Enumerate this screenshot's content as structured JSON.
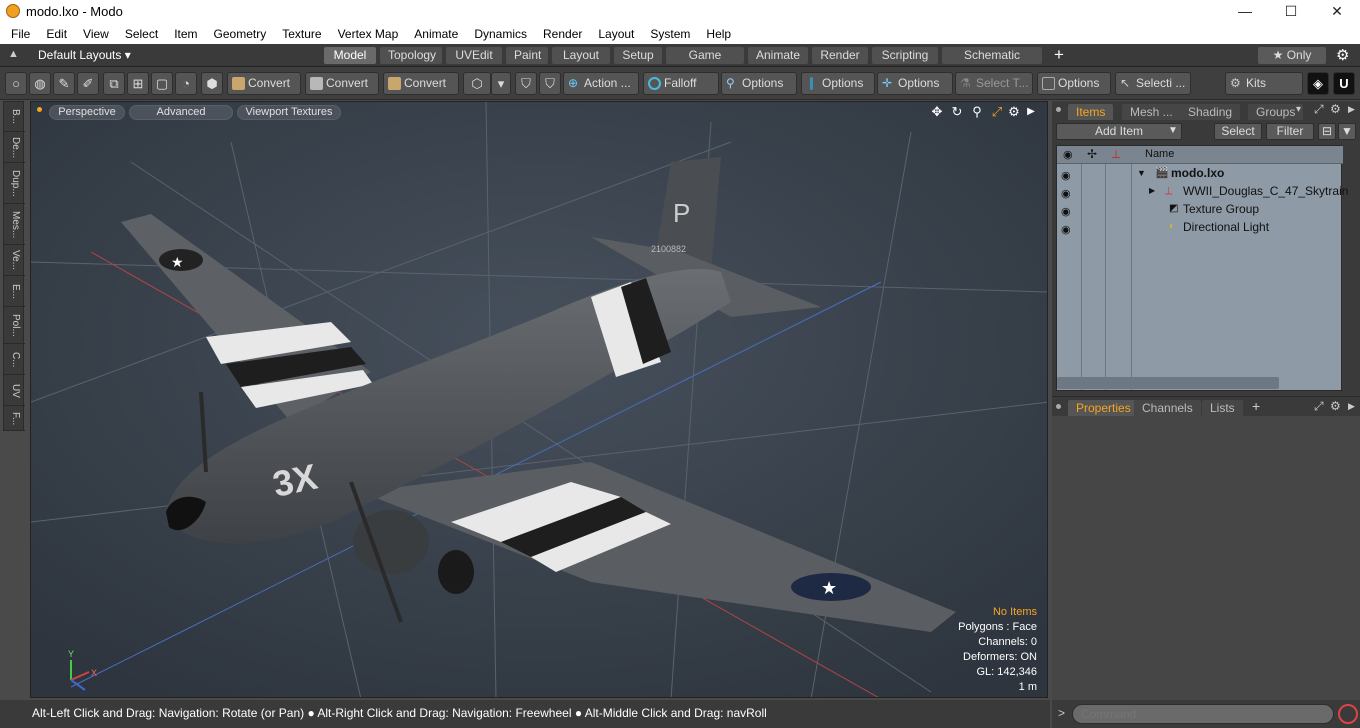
{
  "window": {
    "title": "modo.lxo - Modo",
    "minimize": "—",
    "maximize": "☐",
    "close": "✕"
  },
  "menu": [
    "File",
    "Edit",
    "View",
    "Select",
    "Item",
    "Geometry",
    "Texture",
    "Vertex Map",
    "Animate",
    "Dynamics",
    "Render",
    "Layout",
    "System",
    "Help"
  ],
  "layouts": {
    "label": "Default Layouts ▾"
  },
  "layout_tabs": [
    "Model",
    "Topology",
    "UVEdit",
    "Paint",
    "Layout",
    "Setup",
    "Game Tools",
    "Animate",
    "Render",
    "Scripting",
    "Schematic Fusion"
  ],
  "active_layout_tab": "Model",
  "only_label": "★ Only",
  "toolbar": {
    "convert1": "Convert",
    "convert2": "Convert",
    "convert3": "Convert",
    "action": "Action ...",
    "falloff": "Falloff",
    "options1": "Options",
    "options2": "Options",
    "options3": "Options",
    "select_t": "Select T...",
    "options4": "Options",
    "selecti": "Selecti ...",
    "kits": "Kits"
  },
  "left_tabs": [
    "B...",
    "De...",
    "Dup...",
    "Mes...",
    "Ve...",
    "E...",
    "Pol...",
    "C...",
    "UV",
    "F..."
  ],
  "viewport": {
    "perspective": "Perspective",
    "advanced": "Advanced",
    "textures": "Viewport Textures",
    "info": {
      "no_items": "No Items",
      "polygons": "Polygons : Face",
      "channels": "Channels: 0",
      "deformers": "Deformers: ON",
      "gl": "GL: 142,346",
      "scale": "1 m"
    },
    "axis": {
      "y": "Y",
      "x": "X"
    },
    "decals": {
      "tail_letter": "P",
      "tail_number": "2100882",
      "nose_code": "3X"
    }
  },
  "status": "Alt-Left Click and Drag: Navigation: Rotate (or Pan) ● Alt-Right Click and Drag: Navigation: Freewheel ● Alt-Middle Click and Drag: navRoll",
  "items_panel": {
    "tabs": [
      "Items",
      "Mesh ...",
      "Shading",
      "Groups"
    ],
    "add_item": "Add Item",
    "select": "Select",
    "filter": "Filter",
    "column_name": "Name",
    "rows": [
      {
        "name": "modo.lxo",
        "bold": true
      },
      {
        "name": "WWII_Douglas_C_47_Skytrain"
      },
      {
        "name": "Texture Group"
      },
      {
        "name": "Directional Light"
      }
    ]
  },
  "properties_panel": {
    "tabs": [
      "Properties",
      "Channels",
      "Lists"
    ],
    "add": "+"
  },
  "command": {
    "placeholder": "Command"
  },
  "colors": {
    "accent": "#f5a623",
    "viewport_bg": "#3b4450",
    "list_bg": "#8e9aa6"
  }
}
